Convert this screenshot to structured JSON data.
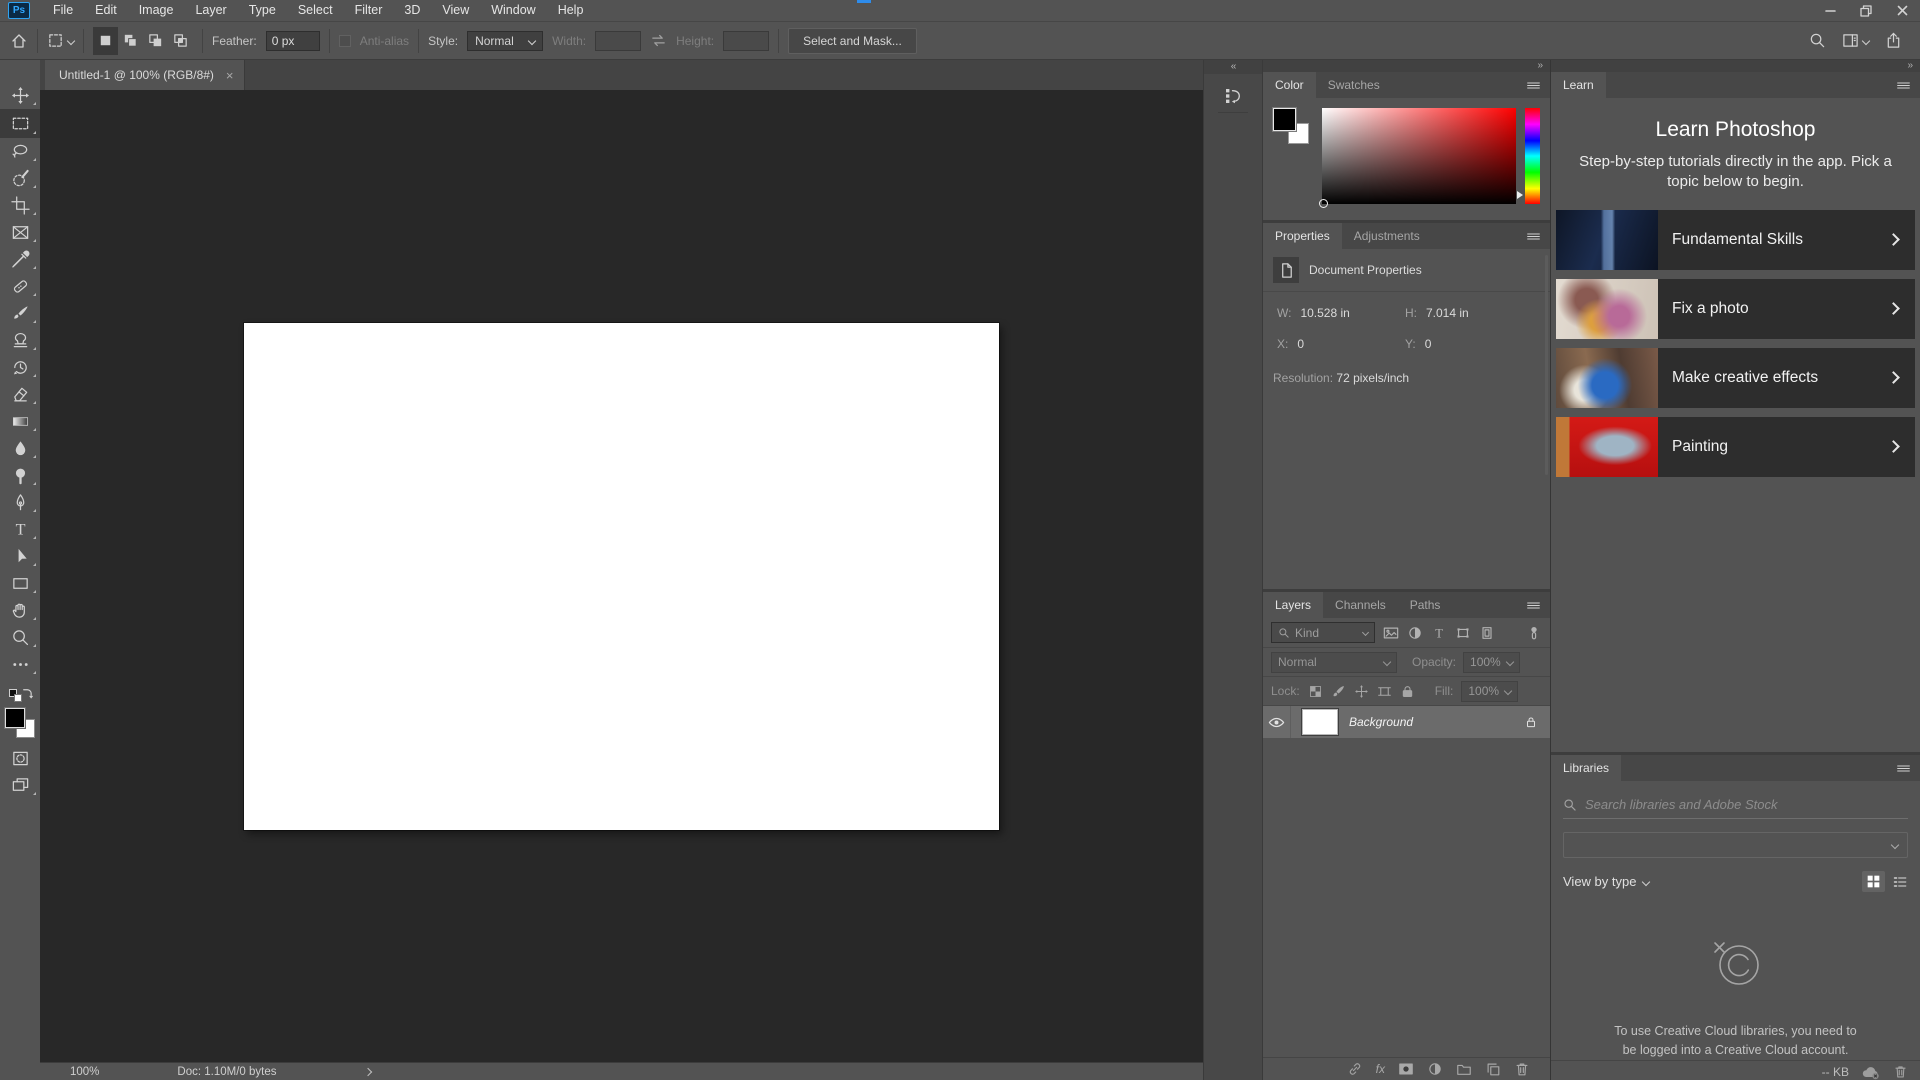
{
  "titlebar": {
    "logo": "Ps",
    "menus": [
      "File",
      "Edit",
      "Image",
      "Layer",
      "Type",
      "Select",
      "Filter",
      "3D",
      "View",
      "Window",
      "Help"
    ]
  },
  "options_bar": {
    "feather_label": "Feather:",
    "feather_value": "0 px",
    "anti_alias_label": "Anti-alias",
    "style_label": "Style:",
    "style_value": "Normal",
    "width_label": "Width:",
    "height_label": "Height:",
    "select_and_mask_label": "Select and Mask..."
  },
  "document_tab": {
    "title": "Untitled-1 @ 100% (RGB/8#)",
    "close": "×"
  },
  "toolbar": {
    "tools": [
      "move-tool",
      "rectangular-marquee-tool",
      "lasso-tool",
      "quick-selection-tool",
      "crop-tool",
      "frame-tool",
      "eyedropper-tool",
      "spot-healing-brush-tool",
      "brush-tool",
      "clone-stamp-tool",
      "history-brush-tool",
      "eraser-tool",
      "gradient-tool",
      "blur-tool",
      "dodge-tool",
      "pen-tool",
      "type-tool",
      "path-selection-tool",
      "rectangle-tool",
      "hand-tool",
      "zoom-tool",
      "edit-toolbar"
    ],
    "foreground_color": "#000000",
    "background_color": "#ffffff"
  },
  "status_bar": {
    "zoom_value": "100%",
    "doc_info": "Doc: 1.10M/0 bytes"
  },
  "color_panel": {
    "tabs": [
      "Color",
      "Swatches"
    ]
  },
  "properties_panel": {
    "tabs": [
      "Properties",
      "Adjustments"
    ],
    "section_title": "Document Properties",
    "w_label": "W:",
    "w_value": "10.528 in",
    "h_label": "H:",
    "h_value": "7.014 in",
    "x_label": "X:",
    "x_value": "0",
    "y_label": "Y:",
    "y_value": "0",
    "resolution_label": "Resolution:",
    "resolution_value": "72 pixels/inch"
  },
  "layers_panel": {
    "tabs": [
      "Layers",
      "Channels",
      "Paths"
    ],
    "kind_label": "Kind",
    "blend_mode": "Normal",
    "opacity_label": "Opacity:",
    "opacity_value": "100%",
    "lock_label": "Lock:",
    "fill_label": "Fill:",
    "fill_value": "100%",
    "layer_name": "Background"
  },
  "learn_panel": {
    "tab": "Learn",
    "title": "Learn Photoshop",
    "subtitle": "Step-by-step tutorials directly in the app. Pick a topic below to begin.",
    "cards": [
      {
        "title": "Fundamental Skills"
      },
      {
        "title": "Fix a photo"
      },
      {
        "title": "Make creative effects"
      },
      {
        "title": "Painting"
      }
    ]
  },
  "libraries_panel": {
    "tab": "Libraries",
    "search_placeholder": "Search libraries and Adobe Stock",
    "view_by_label": "View by type",
    "message": "To use Creative Cloud libraries, you need to be logged into a Creative Cloud account.",
    "size_label": "-- KB"
  }
}
